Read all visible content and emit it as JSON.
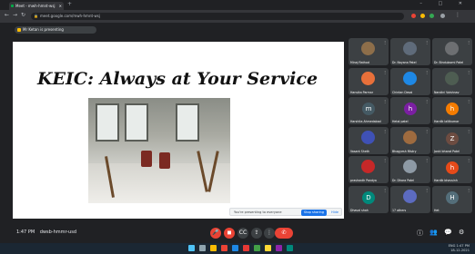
{
  "browser": {
    "tab_title": "Meet - mwh-hmnt-wsj",
    "address": "meet.google.com/mwh-hmnt-wsj",
    "new_tab_label": "+",
    "window_controls": "– □ ✕"
  },
  "presentation": {
    "banner_label": "Mr Ketan is presenting"
  },
  "slide": {
    "title": "KEIC: Always at Your Service"
  },
  "notice": {
    "text": "You're presenting to everyone",
    "share_label": "Stop sharing",
    "hide_label": "Hide"
  },
  "participants": [
    {
      "name": "Minaj Rathod",
      "kind": "photo",
      "color": "#8d6e4a"
    },
    {
      "name": "Dr. Nayana Patel",
      "kind": "photo",
      "color": "#5f6b7a"
    },
    {
      "name": "Dr. Bindulaxmi Patel",
      "kind": "photo",
      "color": "#6d6f72"
    },
    {
      "name": "Hansika Parmar",
      "kind": "photo",
      "color": "#e8703a"
    },
    {
      "name": "Chintan Desai",
      "kind": "photo",
      "color": "#1e88e5"
    },
    {
      "name": "Nandini Vaishnav",
      "kind": "photo",
      "color": "#4e5d52"
    },
    {
      "name": "Harshita Ahmedabad",
      "kind": "initial",
      "initial": "m",
      "color": "#455a64"
    },
    {
      "name": "Hetal patel",
      "kind": "initial",
      "initial": "h",
      "color": "#7b1fa2"
    },
    {
      "name": "Hardik lalitkumar",
      "kind": "initial",
      "initial": "h",
      "color": "#f57c00"
    },
    {
      "name": "Vasant Sheth",
      "kind": "photo",
      "color": "#3f51b5"
    },
    {
      "name": "Bhagyesh Mistry",
      "kind": "photo",
      "color": "#9e6b3f"
    },
    {
      "name": "Janki bharat Patel",
      "kind": "initial",
      "initial": "Z",
      "color": "#6d4c41"
    },
    {
      "name": "prashanth Pandya",
      "kind": "photo",
      "color": "#c62828"
    },
    {
      "name": "Dr. Dhara Patel",
      "kind": "photo",
      "color": "#8e9aa5"
    },
    {
      "name": "Hardik bhavsinh",
      "kind": "initial",
      "initial": "h",
      "color": "#e64a19"
    },
    {
      "name": "Dhaval shah",
      "kind": "initial",
      "initial": "D",
      "color": "#00897b"
    },
    {
      "name": "17 others",
      "kind": "photo",
      "color": "#5c6bc0"
    },
    {
      "name": "Het",
      "kind": "initial",
      "initial": "H",
      "color": "#546e7a"
    }
  ],
  "bottom": {
    "time": "1:47 PM",
    "meeting_code": "dwsb-hmmr-usd",
    "end_label": "✆",
    "mic_icon": "🎤",
    "cam_icon": "◼",
    "cc_icon": "CC",
    "present_icon": "⇪",
    "more_icon": "⋮",
    "info_icon": "ⓘ",
    "people_icon": "👥",
    "chat_icon": "💬",
    "activities_icon": "⚙"
  },
  "taskbar": {
    "tray_line1": "ENG 1:47 PM",
    "tray_line2": "18-12-2021"
  },
  "colors": {
    "end_call": "#ea4335",
    "accent": "#1a73e8"
  }
}
